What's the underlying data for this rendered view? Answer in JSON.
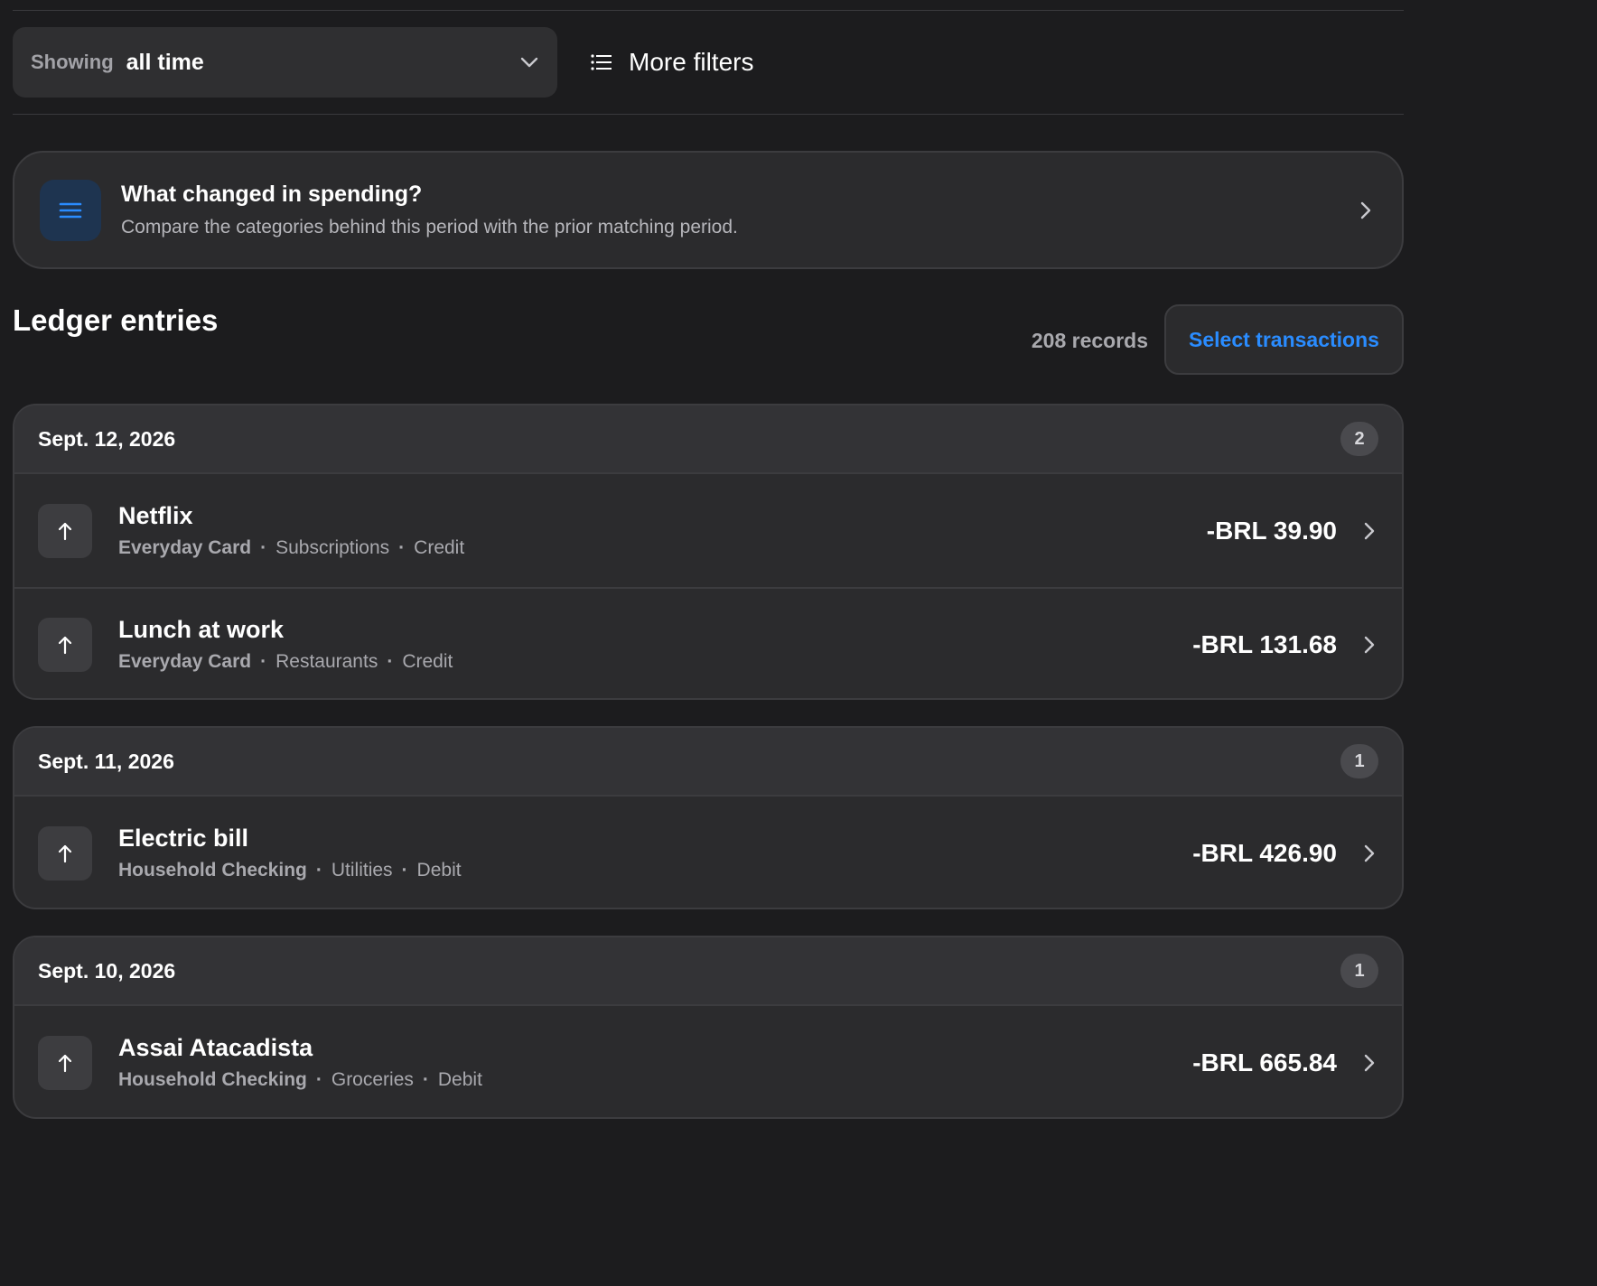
{
  "filters": {
    "period_prefix": "Showing",
    "period_value": "all time",
    "more_filters_label": "More filters"
  },
  "insight": {
    "title": "What changed in spending?",
    "subtitle": "Compare the categories behind this period with the prior matching period."
  },
  "ledger": {
    "title": "Ledger entries",
    "records_count": "208 records",
    "select_label": "Select transactions",
    "groups": [
      {
        "date": "Sept. 12, 2026",
        "count": "2",
        "transactions": [
          {
            "name": "Netflix",
            "account": "Everyday Card",
            "category": "Subscriptions",
            "type": "Credit",
            "amount": "-BRL 39.90"
          },
          {
            "name": "Lunch at work",
            "account": "Everyday Card",
            "category": "Restaurants",
            "type": "Credit",
            "amount": "-BRL 131.68"
          }
        ]
      },
      {
        "date": "Sept. 11, 2026",
        "count": "1",
        "transactions": [
          {
            "name": "Electric bill",
            "account": "Household Checking",
            "category": "Utilities",
            "type": "Debit",
            "amount": "-BRL 426.90"
          }
        ]
      },
      {
        "date": "Sept. 10, 2026",
        "count": "1",
        "transactions": [
          {
            "name": "Assai Atacadista",
            "account": "Household Checking",
            "category": "Groceries",
            "type": "Debit",
            "amount": "-BRL 665.84"
          }
        ]
      }
    ]
  },
  "separator": "·",
  "icons": {
    "period_chevron": "chevron-down-icon",
    "filters": "list-icon",
    "insight": "list-icon",
    "row_direction": "arrow-up-icon",
    "row_chevron": "chevron-right-icon"
  },
  "colors": {
    "accent": "#2a8cff",
    "background": "#1c1c1e",
    "card": "#2b2b2d"
  }
}
